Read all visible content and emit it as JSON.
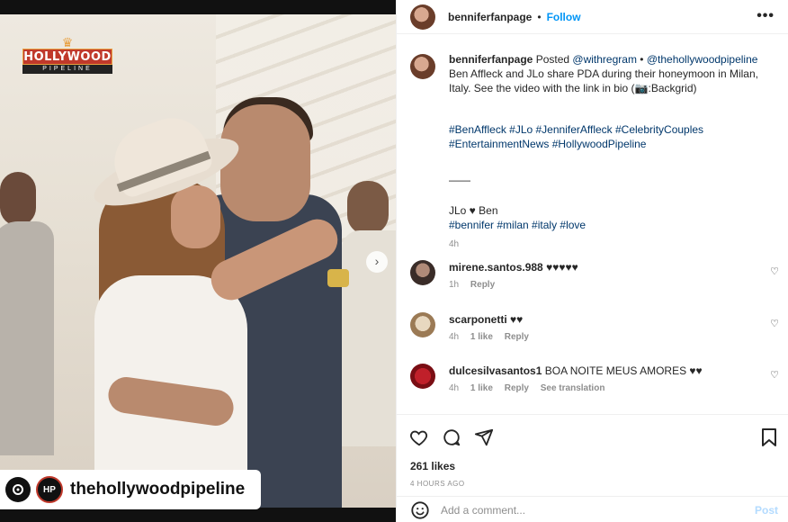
{
  "photo": {
    "watermark_title": "HOLLYWOOD",
    "watermark_sub": "PIPELINE",
    "credit_badge": "HP",
    "credit_name": "thehollywoodpipeline",
    "next_icon": "chevron-right-icon"
  },
  "header": {
    "username": "benniferfanpage",
    "dot": "•",
    "follow": "Follow",
    "more": "•••"
  },
  "caption": {
    "username": "benniferfanpage",
    "posted": "Posted",
    "mention1": "@withregram",
    "dot": "•",
    "mention2": "@thehollywoodpipeline",
    "text": "Ben Affleck and JLo share PDA during their honeymoon in Milan, Italy. See the video with the link in bio (📷:Backgrid)",
    "tags_line1": "#BenAffleck #JLo #JenniferAffleck #CelebrityCouples",
    "tags_line2": "#EntertainmentNews #HollywoodPipeline",
    "divider": "——",
    "heart_line": "JLo ♥ Ben",
    "tags_line3": "#bennifer #milan #italy #love",
    "time": "4h"
  },
  "comments": [
    {
      "username": "mirene.santos.988",
      "text": "♥♥♥♥♥",
      "time": "1h",
      "likes": "",
      "reply": "Reply",
      "translate": ""
    },
    {
      "username": "scarponetti",
      "text": "♥♥",
      "time": "4h",
      "likes": "1 like",
      "reply": "Reply",
      "translate": ""
    },
    {
      "username": "dulcesilvasantos1",
      "text": "BOA NOITE MEUS AMORES ♥♥",
      "time": "4h",
      "likes": "1 like",
      "reply": "Reply",
      "translate": "See translation"
    }
  ],
  "actions": {
    "likes": "261 likes",
    "posted_time": "4 HOURS AGO",
    "comment_placeholder": "Add a comment...",
    "post_label": "Post"
  },
  "colors": {
    "link": "#0095f6",
    "tag": "#00376b",
    "muted": "#8e8e8e",
    "watermark_red": "#c0392b"
  }
}
